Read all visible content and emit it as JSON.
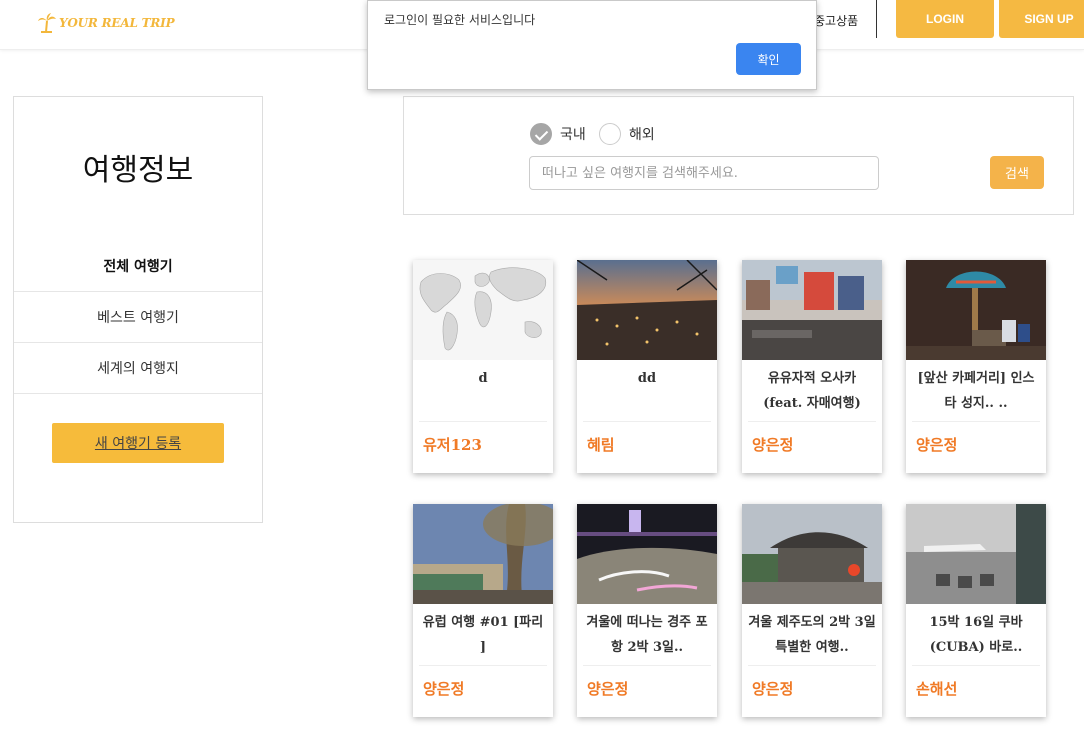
{
  "header": {
    "logo_text": "YOUR REAL TRIP",
    "nav_used_label": "중고상품",
    "login_label": "LOGIN",
    "signup_label": "SIGN UP",
    "accent_color": "#f5b942"
  },
  "dialog": {
    "message": "로그인이 필요한 서비스입니다",
    "ok_label": "확인"
  },
  "sidebar": {
    "title": "여행정보",
    "items": [
      {
        "label": "전체 여행기",
        "active": true
      },
      {
        "label": "베스트 여행기",
        "active": false
      },
      {
        "label": "세계의 여행지",
        "active": false
      }
    ],
    "new_post_label": "새 여행기 등록"
  },
  "search": {
    "radio_domestic": "국내",
    "radio_overseas": "해외",
    "selected": "국내",
    "placeholder": "떠나고 싶은 여행지를 검색해주세요.",
    "button_label": "검색"
  },
  "cards": [
    {
      "title": "d",
      "author": "유저123",
      "image": "world-map"
    },
    {
      "title": "dd",
      "author": "혜림",
      "image": "night-city"
    },
    {
      "title": "유유자적 오사카 (feat. 자매여행)",
      "author": "양은정",
      "image": "osaka-street"
    },
    {
      "title": "[앞산 카페거리] 인스타 성지.. ..",
      "author": "양은정",
      "image": "cafe-lamp"
    },
    {
      "title": "유럽 여행 #01 [파리 ]",
      "author": "양은정",
      "image": "paris-park"
    },
    {
      "title": "겨울에 떠나는 경주 포항 2박 3일..",
      "author": "양은정",
      "image": "night-beach"
    },
    {
      "title": "겨울 제주도의 2박 3일 특별한 여행..",
      "author": "양은정",
      "image": "jeju-house"
    },
    {
      "title": "15박 16일 쿠바 (CUBA) 바로..",
      "author": "손해선",
      "image": "airport"
    }
  ]
}
